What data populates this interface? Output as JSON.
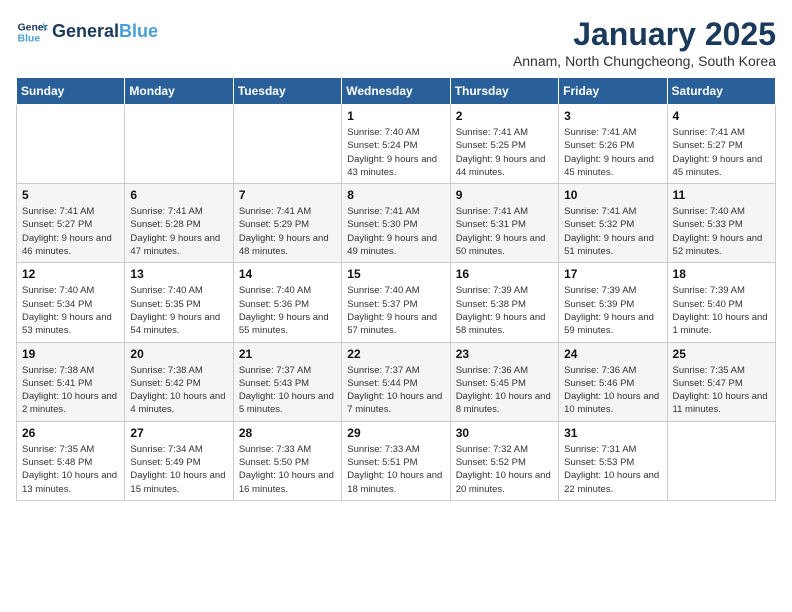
{
  "header": {
    "logo_line1": "General",
    "logo_line2": "Blue",
    "month_year": "January 2025",
    "location": "Annam, North Chungcheong, South Korea"
  },
  "weekdays": [
    "Sunday",
    "Monday",
    "Tuesday",
    "Wednesday",
    "Thursday",
    "Friday",
    "Saturday"
  ],
  "weeks": [
    [
      {
        "day": "",
        "info": ""
      },
      {
        "day": "",
        "info": ""
      },
      {
        "day": "",
        "info": ""
      },
      {
        "day": "1",
        "info": "Sunrise: 7:40 AM\nSunset: 5:24 PM\nDaylight: 9 hours and 43 minutes."
      },
      {
        "day": "2",
        "info": "Sunrise: 7:41 AM\nSunset: 5:25 PM\nDaylight: 9 hours and 44 minutes."
      },
      {
        "day": "3",
        "info": "Sunrise: 7:41 AM\nSunset: 5:26 PM\nDaylight: 9 hours and 45 minutes."
      },
      {
        "day": "4",
        "info": "Sunrise: 7:41 AM\nSunset: 5:27 PM\nDaylight: 9 hours and 45 minutes."
      }
    ],
    [
      {
        "day": "5",
        "info": "Sunrise: 7:41 AM\nSunset: 5:27 PM\nDaylight: 9 hours and 46 minutes."
      },
      {
        "day": "6",
        "info": "Sunrise: 7:41 AM\nSunset: 5:28 PM\nDaylight: 9 hours and 47 minutes."
      },
      {
        "day": "7",
        "info": "Sunrise: 7:41 AM\nSunset: 5:29 PM\nDaylight: 9 hours and 48 minutes."
      },
      {
        "day": "8",
        "info": "Sunrise: 7:41 AM\nSunset: 5:30 PM\nDaylight: 9 hours and 49 minutes."
      },
      {
        "day": "9",
        "info": "Sunrise: 7:41 AM\nSunset: 5:31 PM\nDaylight: 9 hours and 50 minutes."
      },
      {
        "day": "10",
        "info": "Sunrise: 7:41 AM\nSunset: 5:32 PM\nDaylight: 9 hours and 51 minutes."
      },
      {
        "day": "11",
        "info": "Sunrise: 7:40 AM\nSunset: 5:33 PM\nDaylight: 9 hours and 52 minutes."
      }
    ],
    [
      {
        "day": "12",
        "info": "Sunrise: 7:40 AM\nSunset: 5:34 PM\nDaylight: 9 hours and 53 minutes."
      },
      {
        "day": "13",
        "info": "Sunrise: 7:40 AM\nSunset: 5:35 PM\nDaylight: 9 hours and 54 minutes."
      },
      {
        "day": "14",
        "info": "Sunrise: 7:40 AM\nSunset: 5:36 PM\nDaylight: 9 hours and 55 minutes."
      },
      {
        "day": "15",
        "info": "Sunrise: 7:40 AM\nSunset: 5:37 PM\nDaylight: 9 hours and 57 minutes."
      },
      {
        "day": "16",
        "info": "Sunrise: 7:39 AM\nSunset: 5:38 PM\nDaylight: 9 hours and 58 minutes."
      },
      {
        "day": "17",
        "info": "Sunrise: 7:39 AM\nSunset: 5:39 PM\nDaylight: 9 hours and 59 minutes."
      },
      {
        "day": "18",
        "info": "Sunrise: 7:39 AM\nSunset: 5:40 PM\nDaylight: 10 hours and 1 minute."
      }
    ],
    [
      {
        "day": "19",
        "info": "Sunrise: 7:38 AM\nSunset: 5:41 PM\nDaylight: 10 hours and 2 minutes."
      },
      {
        "day": "20",
        "info": "Sunrise: 7:38 AM\nSunset: 5:42 PM\nDaylight: 10 hours and 4 minutes."
      },
      {
        "day": "21",
        "info": "Sunrise: 7:37 AM\nSunset: 5:43 PM\nDaylight: 10 hours and 5 minutes."
      },
      {
        "day": "22",
        "info": "Sunrise: 7:37 AM\nSunset: 5:44 PM\nDaylight: 10 hours and 7 minutes."
      },
      {
        "day": "23",
        "info": "Sunrise: 7:36 AM\nSunset: 5:45 PM\nDaylight: 10 hours and 8 minutes."
      },
      {
        "day": "24",
        "info": "Sunrise: 7:36 AM\nSunset: 5:46 PM\nDaylight: 10 hours and 10 minutes."
      },
      {
        "day": "25",
        "info": "Sunrise: 7:35 AM\nSunset: 5:47 PM\nDaylight: 10 hours and 11 minutes."
      }
    ],
    [
      {
        "day": "26",
        "info": "Sunrise: 7:35 AM\nSunset: 5:48 PM\nDaylight: 10 hours and 13 minutes."
      },
      {
        "day": "27",
        "info": "Sunrise: 7:34 AM\nSunset: 5:49 PM\nDaylight: 10 hours and 15 minutes."
      },
      {
        "day": "28",
        "info": "Sunrise: 7:33 AM\nSunset: 5:50 PM\nDaylight: 10 hours and 16 minutes."
      },
      {
        "day": "29",
        "info": "Sunrise: 7:33 AM\nSunset: 5:51 PM\nDaylight: 10 hours and 18 minutes."
      },
      {
        "day": "30",
        "info": "Sunrise: 7:32 AM\nSunset: 5:52 PM\nDaylight: 10 hours and 20 minutes."
      },
      {
        "day": "31",
        "info": "Sunrise: 7:31 AM\nSunset: 5:53 PM\nDaylight: 10 hours and 22 minutes."
      },
      {
        "day": "",
        "info": ""
      }
    ]
  ]
}
